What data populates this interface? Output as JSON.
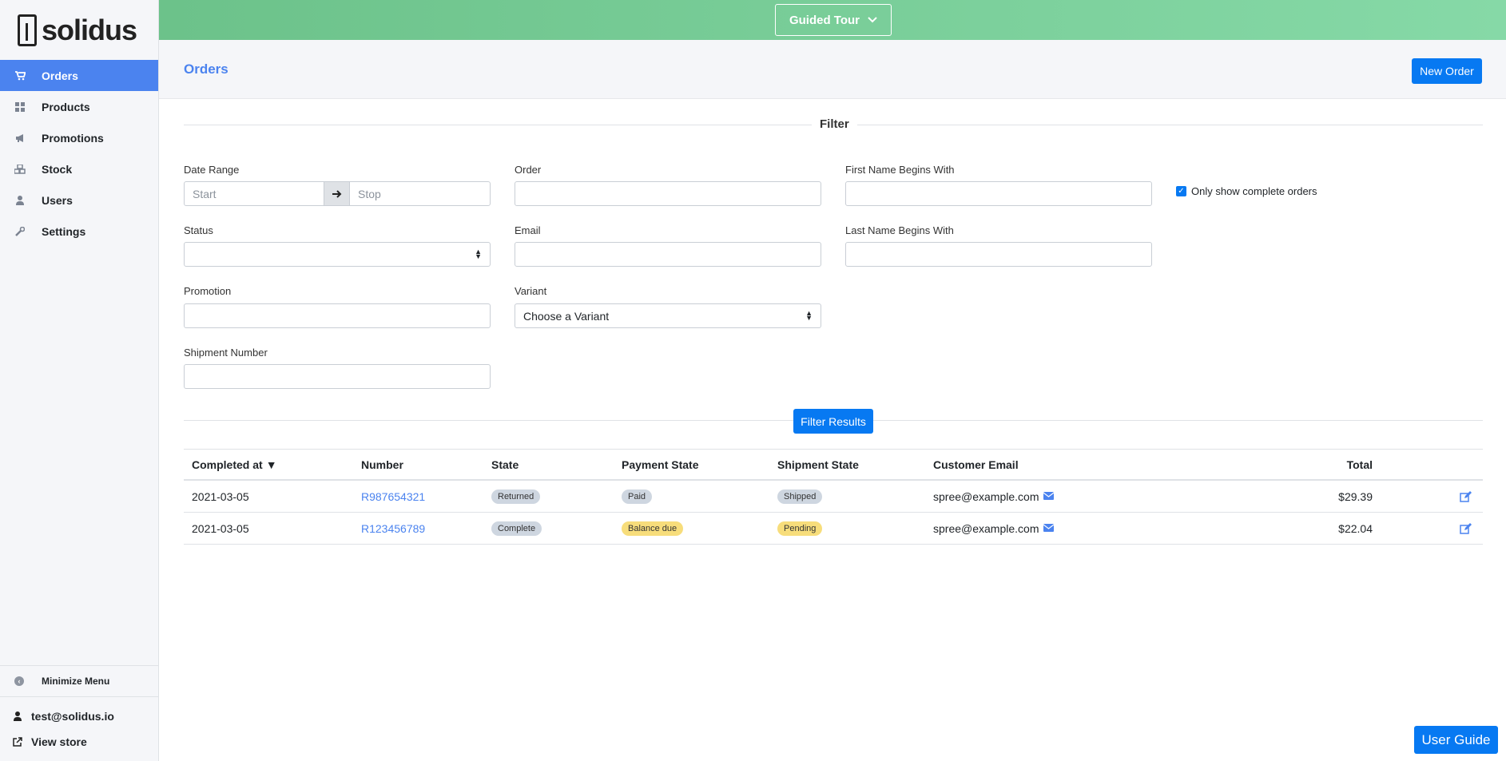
{
  "brand": {
    "logo_text": "solidus"
  },
  "sidebar": {
    "items": [
      {
        "label": "Orders",
        "icon": "cart-icon",
        "active": true
      },
      {
        "label": "Products",
        "icon": "grid-icon"
      },
      {
        "label": "Promotions",
        "icon": "bullhorn-icon"
      },
      {
        "label": "Stock",
        "icon": "cubes-icon"
      },
      {
        "label": "Users",
        "icon": "user-icon"
      },
      {
        "label": "Settings",
        "icon": "wrench-icon"
      }
    ],
    "minimize_label": "Minimize Menu",
    "account_email": "test@solidus.io",
    "view_store_label": "View store"
  },
  "topbar": {
    "guided_tour_label": "Guided Tour"
  },
  "header": {
    "title": "Orders",
    "new_order_label": "New Order"
  },
  "filter": {
    "title": "Filter",
    "date_range_label": "Date Range",
    "start_placeholder": "Start",
    "stop_placeholder": "Stop",
    "order_label": "Order",
    "first_name_label": "First Name Begins With",
    "only_complete_label": "Only show complete orders",
    "only_complete_checked": true,
    "status_label": "Status",
    "email_label": "Email",
    "last_name_label": "Last Name Begins With",
    "promotion_label": "Promotion",
    "variant_label": "Variant",
    "variant_value": "Choose a Variant",
    "shipment_number_label": "Shipment Number",
    "submit_label": "Filter Results"
  },
  "table": {
    "columns": [
      "Completed at",
      "Number",
      "State",
      "Payment State",
      "Shipment State",
      "Customer Email",
      "Total"
    ],
    "sort_indicator": "▼",
    "rows": [
      {
        "completed_at": "2021-03-05",
        "number": "R987654321",
        "state": "Returned",
        "payment_state": "Paid",
        "shipment_state": "Shipped",
        "email": "spree@example.com",
        "total": "$29.39"
      },
      {
        "completed_at": "2021-03-05",
        "number": "R123456789",
        "state": "Complete",
        "payment_state": "Balance due",
        "shipment_state": "Pending",
        "email": "spree@example.com",
        "total": "$22.04"
      }
    ]
  },
  "user_guide_label": "User Guide",
  "colors": {
    "primary": "#0779f2",
    "accent": "#4b83ef",
    "topbar_start": "#6cc28a",
    "topbar_end": "#86d9a7",
    "badge_warning": "#f7dd7b",
    "badge_default": "#ced6e0"
  }
}
